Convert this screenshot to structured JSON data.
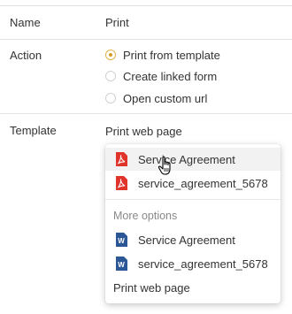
{
  "form": {
    "name_label": "Name",
    "name_value": "Print",
    "action_label": "Action",
    "action_options": [
      {
        "label": "Print from template",
        "checked": true
      },
      {
        "label": "Create linked form",
        "checked": false
      },
      {
        "label": "Open custom url",
        "checked": false
      }
    ],
    "template_label": "Template",
    "template_value": "Print web page"
  },
  "dropdown": {
    "pdf_items": [
      {
        "label": "Service Agreement",
        "icon": "pdf-icon",
        "hovered": true
      },
      {
        "label": "service_agreement_5678",
        "icon": "pdf-icon",
        "hovered": false
      }
    ],
    "section_title": "More options",
    "word_items": [
      {
        "label": "Service Agreement",
        "icon": "word-icon"
      },
      {
        "label": "service_agreement_5678",
        "icon": "word-icon"
      }
    ],
    "last_item": "Print web page"
  },
  "colors": {
    "radio_accent": "#d59b1e",
    "pdf_red": "#e0342b",
    "word_blue": "#2b5797",
    "hover_bg": "#f2f2f2"
  }
}
